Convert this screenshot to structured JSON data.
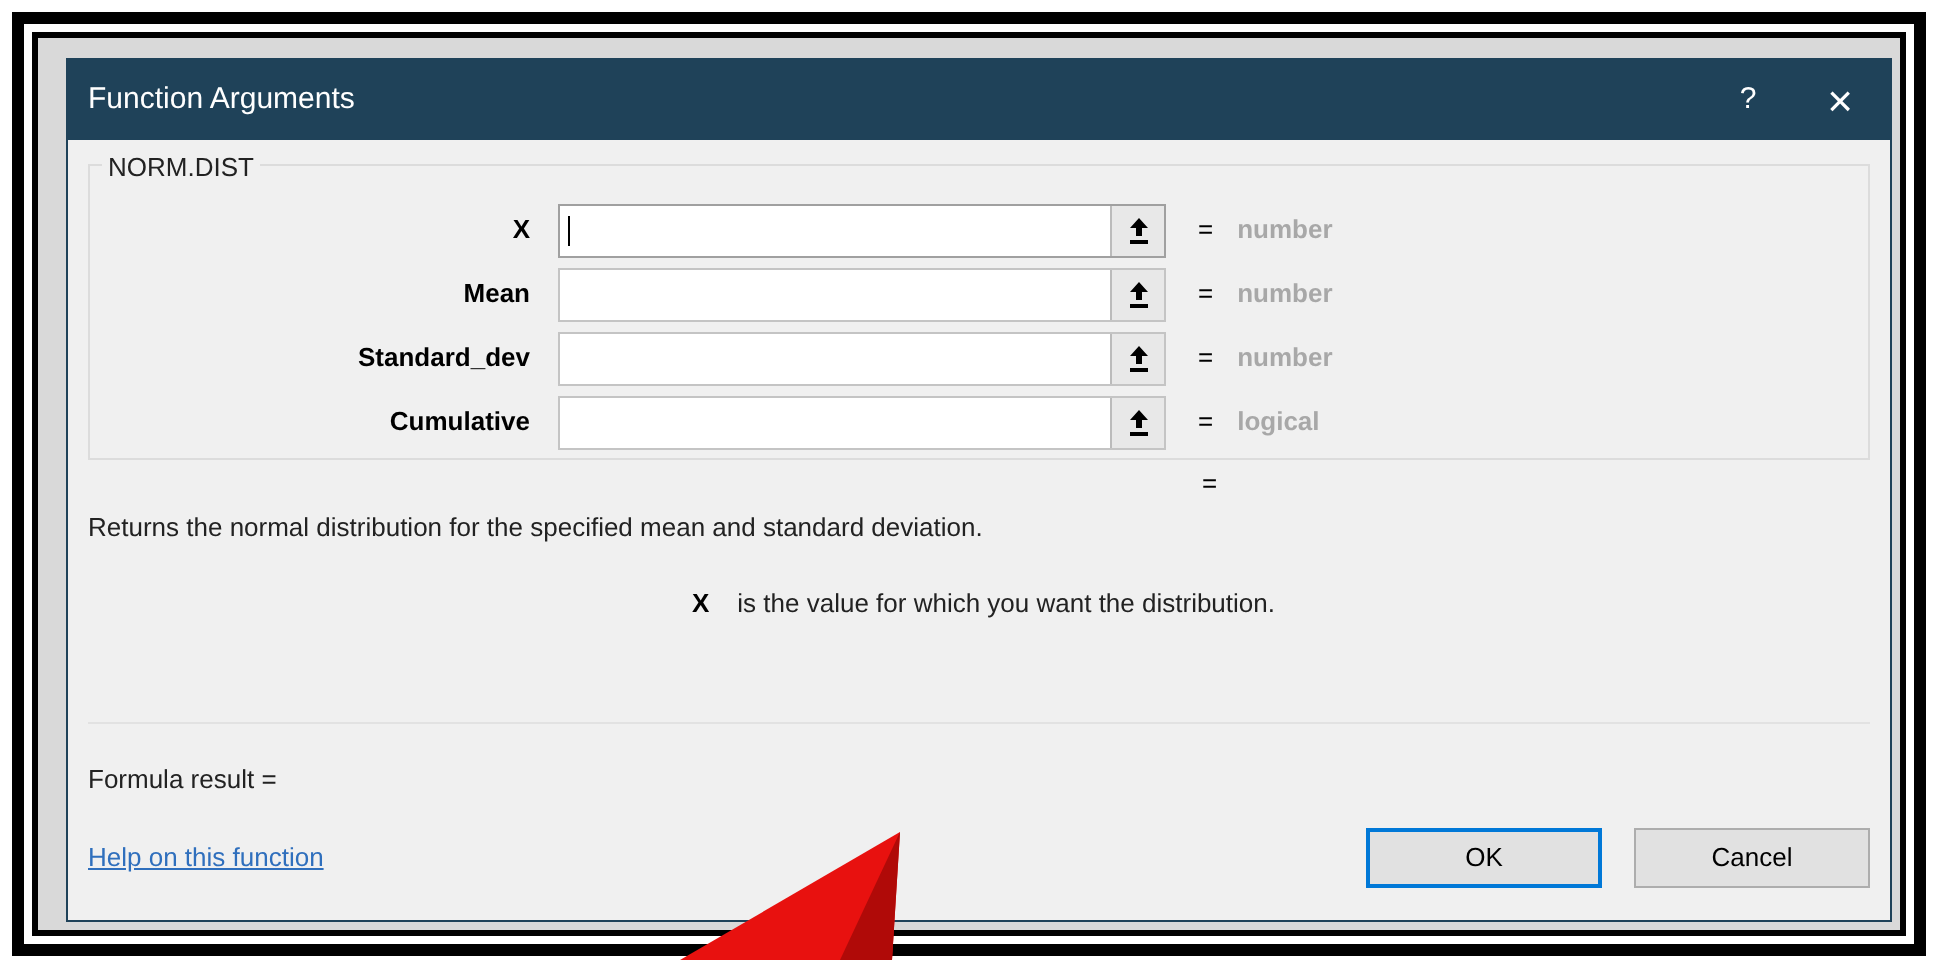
{
  "window": {
    "title": "Function Arguments",
    "help": "?",
    "close": "×"
  },
  "function_name": "NORM.DIST",
  "arguments": [
    {
      "label": "X",
      "focused": true,
      "equals": "=",
      "type_hint": "number"
    },
    {
      "label": "Mean",
      "focused": false,
      "equals": "=",
      "type_hint": "number"
    },
    {
      "label": "Standard_dev",
      "focused": false,
      "equals": "=",
      "type_hint": "number"
    },
    {
      "label": "Cumulative",
      "focused": false,
      "equals": "=",
      "type_hint": "logical"
    }
  ],
  "result_equals": "=",
  "description": "Returns the normal distribution for the specified mean and standard deviation.",
  "argument_help": {
    "name": "X",
    "text": "is the value for which you want the distribution."
  },
  "formula_result": "Formula result =",
  "help_link": "Help on this function",
  "buttons": [
    {
      "label": "OK",
      "selected": true
    },
    {
      "label": "Cancel",
      "selected": false
    }
  ]
}
